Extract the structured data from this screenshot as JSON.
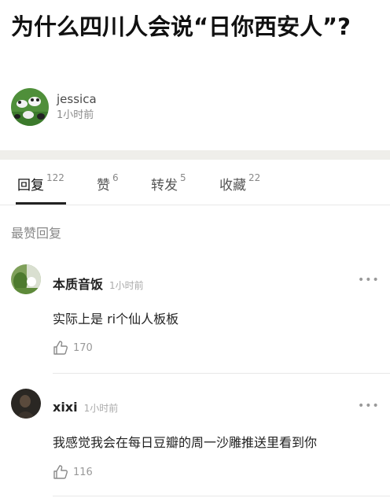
{
  "post": {
    "title": "为什么四川人会说“日你西安人”?",
    "author": "jessica",
    "time": "1小时前"
  },
  "tabs": [
    {
      "label": "回复",
      "count": "122"
    },
    {
      "label": "赞",
      "count": "6"
    },
    {
      "label": "转发",
      "count": "5"
    },
    {
      "label": "收藏",
      "count": "22"
    }
  ],
  "section": {
    "heading": "最赞回复"
  },
  "comments": [
    {
      "author": "本质音饭",
      "time": "1小时前",
      "text": "实际上是 ri个仙人板板",
      "likes": "170"
    },
    {
      "author": "xixi",
      "time": "1小时前",
      "text": "我感觉我会在每日豆瓣的周一沙雕推送里看到你",
      "likes": "116"
    }
  ],
  "colors": {
    "accent": "#222222",
    "band": "#efeeea",
    "muted": "#8a8a8a"
  }
}
